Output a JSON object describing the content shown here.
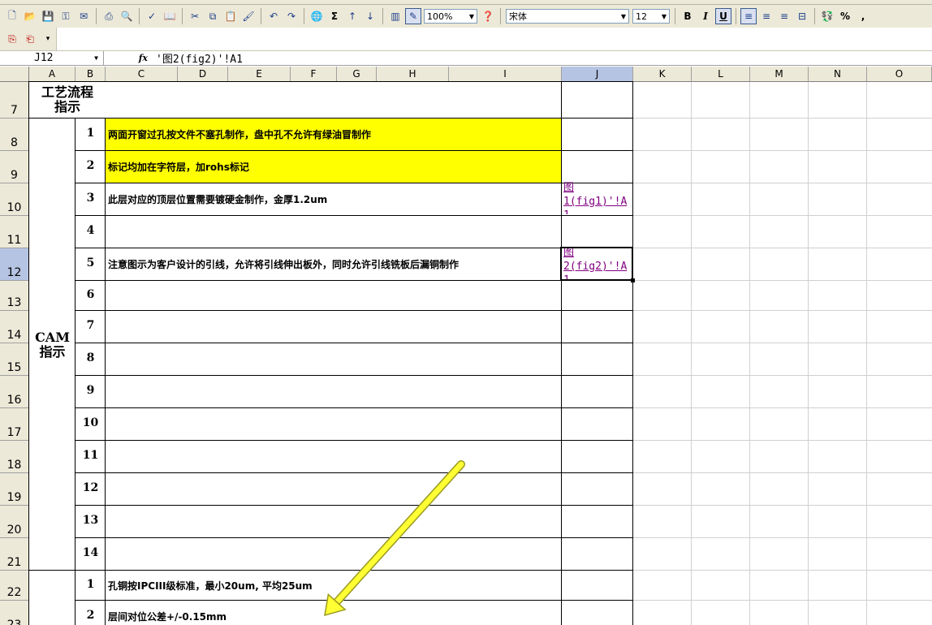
{
  "toolbar": {
    "zoom": "100%",
    "font_name": "宋体",
    "font_size": "12",
    "bold_label": "B",
    "italic_label": "I",
    "underline_label": "U",
    "sum_label": "Σ",
    "percent_label": "%",
    "comma_label": ","
  },
  "formula_bar": {
    "name_box": "J12",
    "fx_label": "fx",
    "content": "'图2(fig2)'!A1"
  },
  "columns": [
    "A",
    "B",
    "C",
    "D",
    "E",
    "F",
    "G",
    "H",
    "I",
    "J",
    "K",
    "L",
    "M",
    "N",
    "O"
  ],
  "rows": [
    "7",
    "8",
    "9",
    "10",
    "11",
    "12",
    "13",
    "14",
    "15",
    "16",
    "17",
    "18",
    "19",
    "20",
    "21",
    "22",
    "23"
  ],
  "sheet": {
    "process_label": "工艺流程\n指示",
    "cam_label": "CAM\n指示",
    "items": [
      {
        "num": "1",
        "text": "两面开窗过孔按文件不塞孔制作，盘中孔不允许有绿油冒制作"
      },
      {
        "num": "2",
        "text": "标记均加在字符层，加rohs标记"
      },
      {
        "num": "3",
        "text": "此层对应的顶层位置需要镀硬金制作，金厚1.2um"
      },
      {
        "num": "4",
        "text": ""
      },
      {
        "num": "5",
        "text": "注意图示为客户设计的引线，允许将引线伸出板外，同时允许引线铣板后漏铜制作"
      },
      {
        "num": "6",
        "text": ""
      },
      {
        "num": "7",
        "text": ""
      },
      {
        "num": "8",
        "text": ""
      },
      {
        "num": "9",
        "text": ""
      },
      {
        "num": "10",
        "text": ""
      },
      {
        "num": "11",
        "text": ""
      },
      {
        "num": "12",
        "text": ""
      },
      {
        "num": "13",
        "text": ""
      },
      {
        "num": "14",
        "text": ""
      }
    ],
    "items2": [
      {
        "num": "1",
        "text": "孔铜按IPCIII级标准，最小20um, 平均25um"
      },
      {
        "num": "2",
        "text": "层间对位公差+/-0.15mm"
      }
    ],
    "link_j10": "图\n1(fig1)'!A\n1",
    "link_j12": "图\n2(fig2)'!A\n1"
  },
  "colors": {
    "highlight": "#ffff00",
    "link": "#800080",
    "arrow": "#ffff33",
    "header_bg": "#ece9d8",
    "selected_header": "#b6c4e3"
  }
}
